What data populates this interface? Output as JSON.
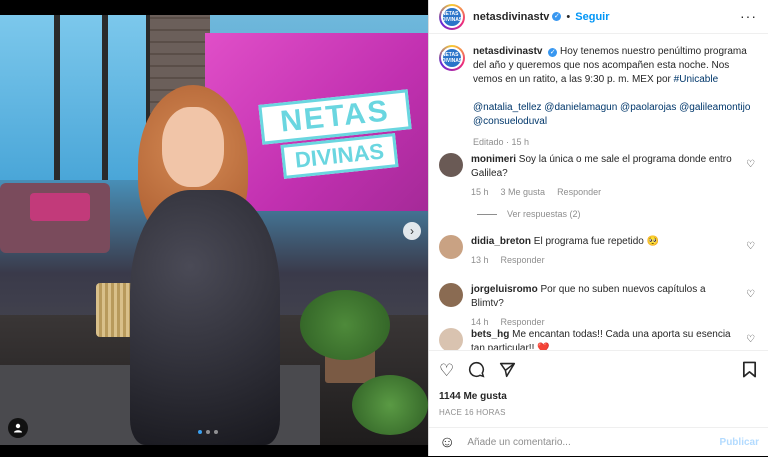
{
  "post": {
    "username": "netasdivinastv",
    "follow_label": "Seguir",
    "separator": "•",
    "more_label": "···",
    "avatar_text": "NETAS DIVINAS",
    "media": {
      "logo_top": "NETAS",
      "logo_bottom": "DIVINAS",
      "slide_count": 3,
      "active_slide": 1
    }
  },
  "caption": {
    "username": "netasdivinastv",
    "text": "Hoy tenemos nuestro penúltimo programa del año y queremos que nos acompañen esta noche. Nos vemos en un ratito, a las 9:30 p. m. MEX por ",
    "hashtag": "#Unicable",
    "mentions": "@natalia_tellez @danielamagun @paolarojas @galileamontijo @consueloduval",
    "meta": "Editado · 15 h"
  },
  "comments": [
    {
      "username": "monimeri",
      "text": "Soy la única o me sale el programa donde entro Galilea?",
      "time": "15 h",
      "likes": "3 Me gusta",
      "reply": "Responder",
      "avatar_color": "#6a5a55"
    },
    {
      "username": "didia_breton",
      "text": "El programa fue repetido 🥺",
      "time": "13 h",
      "likes": "",
      "reply": "Responder",
      "avatar_color": "#c9a283"
    },
    {
      "username": "jorgeluisromo",
      "text": "Por que no suben nuevos capítulos a Blimtv?",
      "time": "14 h",
      "likes": "",
      "reply": "Responder",
      "avatar_color": "#8a6b52"
    },
    {
      "username": "bets_hg",
      "text": "Me encantan todas!! Cada una aporta su esencia tan particular!! ❤️",
      "time": "",
      "likes": "",
      "reply": "",
      "avatar_color": "#d9c3b0"
    }
  ],
  "view_replies": "Ver respuestas (2)",
  "actions": {
    "likes": "1144 Me gusta",
    "date": "HACE 16 HORAS",
    "comment_placeholder": "Añade un comentario...",
    "publish_label": "Publicar"
  },
  "icons": {
    "like": "heart-icon",
    "comment": "comment-icon",
    "share": "share-icon",
    "save": "bookmark-icon",
    "emoji": "emoji-icon",
    "next": "chevron-right-icon",
    "tag": "user-tag-icon"
  },
  "colors": {
    "link": "#00376b",
    "accent": "#0095f6",
    "muted": "#8e8e8e"
  }
}
